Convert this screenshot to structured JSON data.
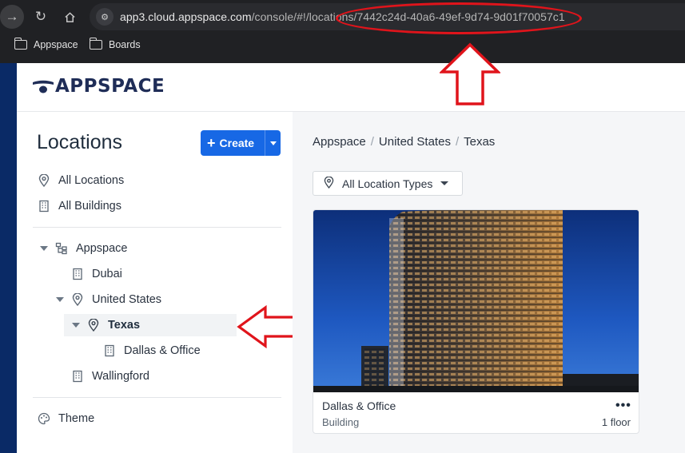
{
  "browser": {
    "url_host": "app3.cloud.appspace.com",
    "url_path": "/console/#!/locations/7442c24d-40a6-49ef-9d74-9d01f70057c1",
    "bookmarks": [
      {
        "label": "Appspace",
        "icon": "folder-icon"
      },
      {
        "label": "Boards",
        "icon": "folder-icon"
      }
    ]
  },
  "brand": {
    "logo_text": "APPSPACE",
    "color": "#1f2d57"
  },
  "sidebar": {
    "title": "Locations",
    "create_label": "Create",
    "links": [
      {
        "label": "All Locations",
        "icon": "location-pin-icon"
      },
      {
        "label": "All Buildings",
        "icon": "building-icon"
      }
    ],
    "tree": [
      {
        "label": "Appspace",
        "icon": "hierarchy-icon",
        "expanded": true
      },
      {
        "label": "Dubai",
        "icon": "building-icon"
      },
      {
        "label": "United States",
        "icon": "location-pin-icon",
        "expanded": true
      },
      {
        "label": "Texas",
        "icon": "location-pin-icon",
        "expanded": true,
        "selected": true
      },
      {
        "label": "Dallas & Office",
        "icon": "building-icon"
      },
      {
        "label": "Wallingford",
        "icon": "building-icon"
      }
    ],
    "theme_label": "Theme"
  },
  "main": {
    "breadcrumb": [
      "Appspace",
      "United States",
      "Texas"
    ],
    "filter_label": "All Location Types",
    "card": {
      "title": "Dallas & Office",
      "type": "Building",
      "floors": "1 floor",
      "menu": "•••"
    }
  },
  "colors": {
    "accent": "#1768e5",
    "annotation": "#e0141b",
    "nav_strip": "#0a2a66"
  }
}
